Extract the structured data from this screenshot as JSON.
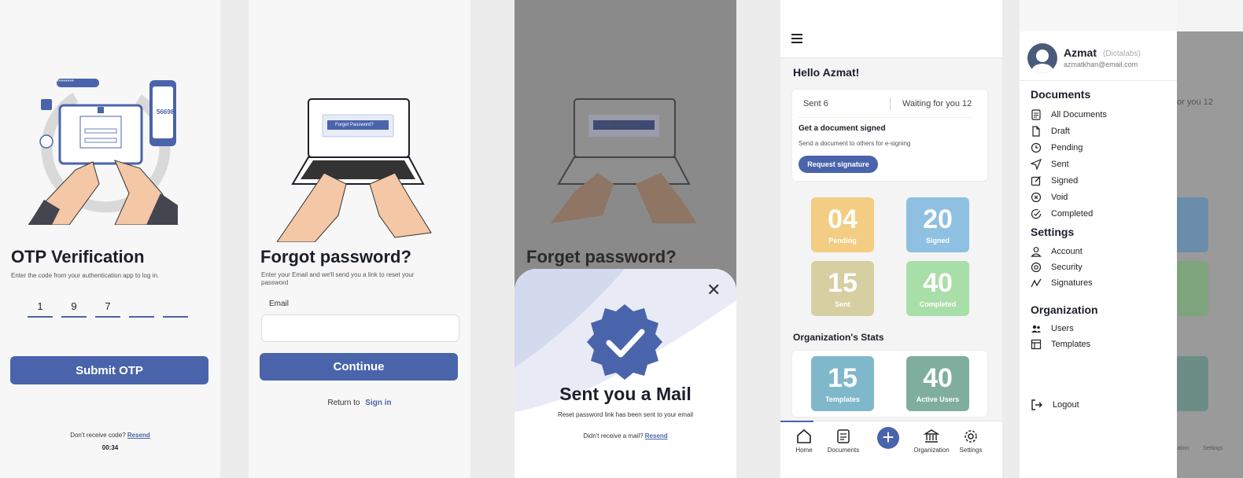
{
  "otp": {
    "illustration_tag": "********",
    "phone_code": "56698",
    "title": "OTP Verification",
    "subtitle": "Enter the code from your authentication app to log in.",
    "digits": [
      "1",
      "9",
      "7",
      "",
      ""
    ],
    "submit_label": "Submit OTP",
    "resend_prompt": "Don't receive code?",
    "resend_link": "Resend",
    "timer": "00:34"
  },
  "forgot": {
    "screen_button": "Forget Password?",
    "title": "Forgot password?",
    "subtitle": "Enter your Email and we'll send you a link to reset  your password",
    "email_label": "Email",
    "email_value": "",
    "continue_label": "Continue",
    "return_prompt": "Return to",
    "signin_link": "Sign in"
  },
  "mail_sent": {
    "bg_title": "Forget password?",
    "bg_screen_button": "Forget Password?",
    "title": "Sent you a Mail",
    "message": "Reset password link has been sent to your email",
    "resend_prompt": "Didn't receive a mail?",
    "resend_link": "Resend"
  },
  "dashboard": {
    "greeting": "Hello Azmat!",
    "sent": "Sent 6",
    "waiting": "Waiting for you 12",
    "card_title": "Get a document signed",
    "card_text": "Send a document to others for e-signing",
    "request_label": "Request signature",
    "tiles": [
      {
        "num": "04",
        "label": "Pending",
        "color": "#f3cd83"
      },
      {
        "num": "20",
        "label": "Signed",
        "color": "#8fc0e2"
      },
      {
        "num": "15",
        "label": "Sent",
        "color": "#d6cfa2"
      },
      {
        "num": "40",
        "label": "Completed",
        "color": "#a8dea7"
      }
    ],
    "org_title": "Organization's Stats",
    "org_tiles": [
      {
        "num": "15",
        "label": "Templates",
        "color": "#80b8cb"
      },
      {
        "num": "40",
        "label": "Active Users",
        "color": "#7fae9f"
      }
    ],
    "nav": {
      "home": "Home",
      "documents": "Documents",
      "organization": "Organization",
      "settings": "Settings"
    }
  },
  "drawer": {
    "name": "Azmat",
    "org": "(Dictalabs)",
    "email": "azmatkhan@email.com",
    "sections": {
      "documents": "Documents",
      "settings": "Settings",
      "organization": "Organization"
    },
    "documents": [
      "All Documents",
      "Draft",
      "Pending",
      "Sent",
      "Signed",
      "Void",
      "Completed"
    ],
    "settings": [
      "Account",
      "Security",
      "Signatures"
    ],
    "organization": [
      "Users",
      "Templates"
    ],
    "logout": "Logout",
    "bg_waiting": "or you 12",
    "bg_nav_partial": "ation",
    "bg_nav_settings": "Settings"
  },
  "colors": {
    "accent": "#4a64ab",
    "text": "#1c1f2a"
  }
}
